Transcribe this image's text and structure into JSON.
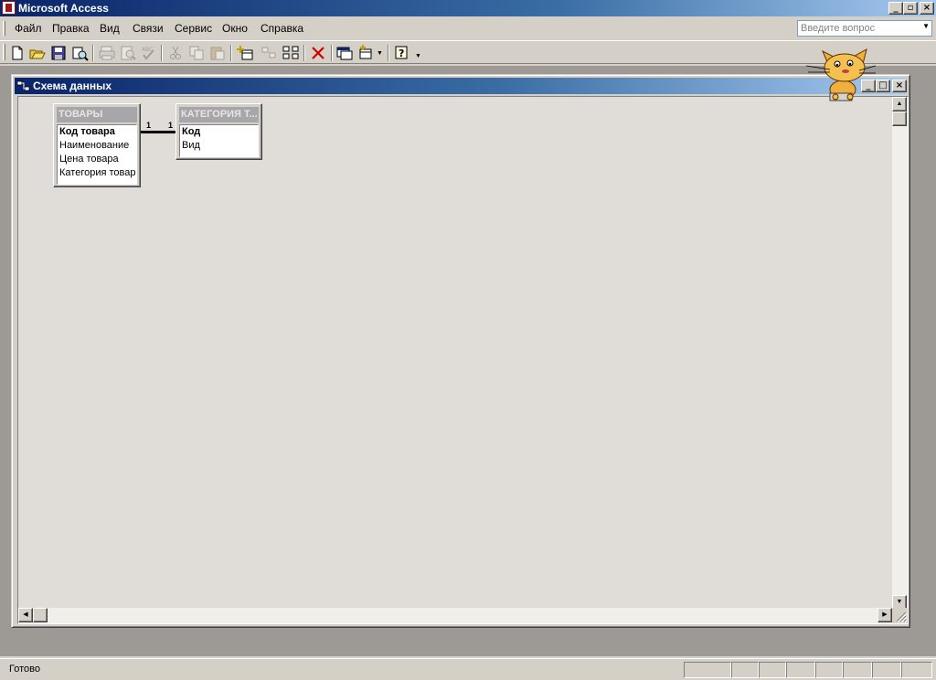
{
  "app": {
    "title": "Microsoft Access"
  },
  "menu": {
    "items": [
      "Файл",
      "Правка",
      "Вид",
      "Связи",
      "Сервис",
      "Окно",
      "Справка"
    ],
    "ask_placeholder": "Введите вопрос"
  },
  "toolbar": {
    "buttons": [
      "new-icon",
      "open-icon",
      "save-icon",
      "print-preview-file-icon",
      "print-icon",
      "print-preview-icon",
      "spelling-icon",
      "cut-icon",
      "copy-icon",
      "paste-icon",
      "show-table-icon",
      "show-direct-relationships-icon",
      "show-all-relationships-icon",
      "delete-icon",
      "database-window-icon",
      "new-object-icon",
      "help-icon"
    ]
  },
  "child_window": {
    "title": "Схема данных"
  },
  "tables": [
    {
      "name": "ТОВАРЫ",
      "primary_key": "Код товара",
      "fields": [
        "Наименование",
        "Цена товара",
        "Категория товара"
      ]
    },
    {
      "name": "КАТЕГОРИЯ Т...",
      "primary_key": "Код",
      "fields": [
        "Вид"
      ]
    }
  ],
  "relationship": {
    "left_cardinality": "1",
    "right_cardinality": "1"
  },
  "status": {
    "text": "Готово"
  },
  "colors": {
    "title_gradient_start": "#0a246a",
    "title_gradient_end": "#a6caf0",
    "workspace": "#9d9a95",
    "window_face": "#d4d0c8",
    "table_header": "#a7a6aa"
  }
}
